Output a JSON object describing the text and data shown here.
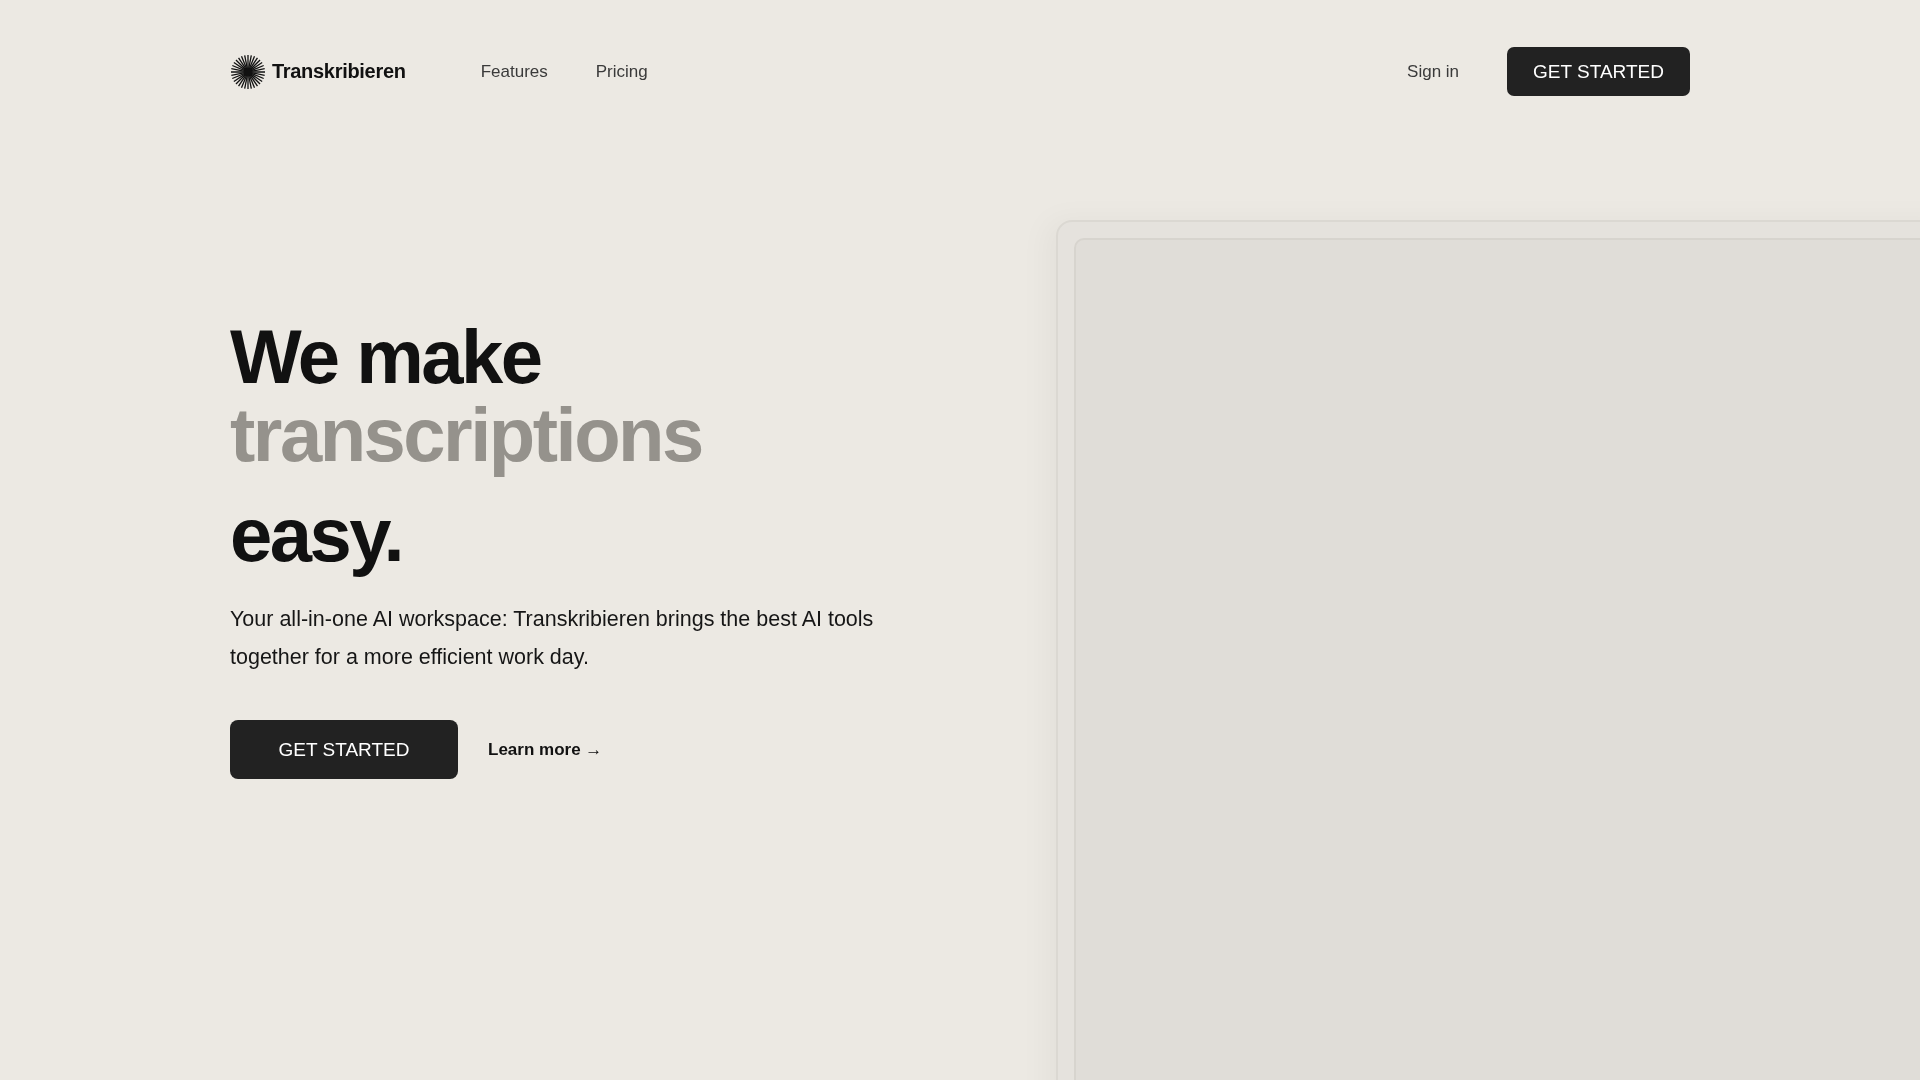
{
  "header": {
    "brand": "Transkribieren",
    "nav": [
      "Features",
      "Pricing"
    ],
    "sign_in": "Sign in",
    "cta": "GET STARTED"
  },
  "hero": {
    "heading_lines": [
      {
        "text": "We make",
        "muted": false
      },
      {
        "text": "transcriptions",
        "muted": true
      },
      {
        "text": "easy.",
        "muted": false
      }
    ],
    "description": "Your all-in-one AI workspace: Transkribieren brings the best AI tools together for a more efficient work day.",
    "primary_button": "GET STARTED",
    "secondary_link": "Learn more →"
  }
}
